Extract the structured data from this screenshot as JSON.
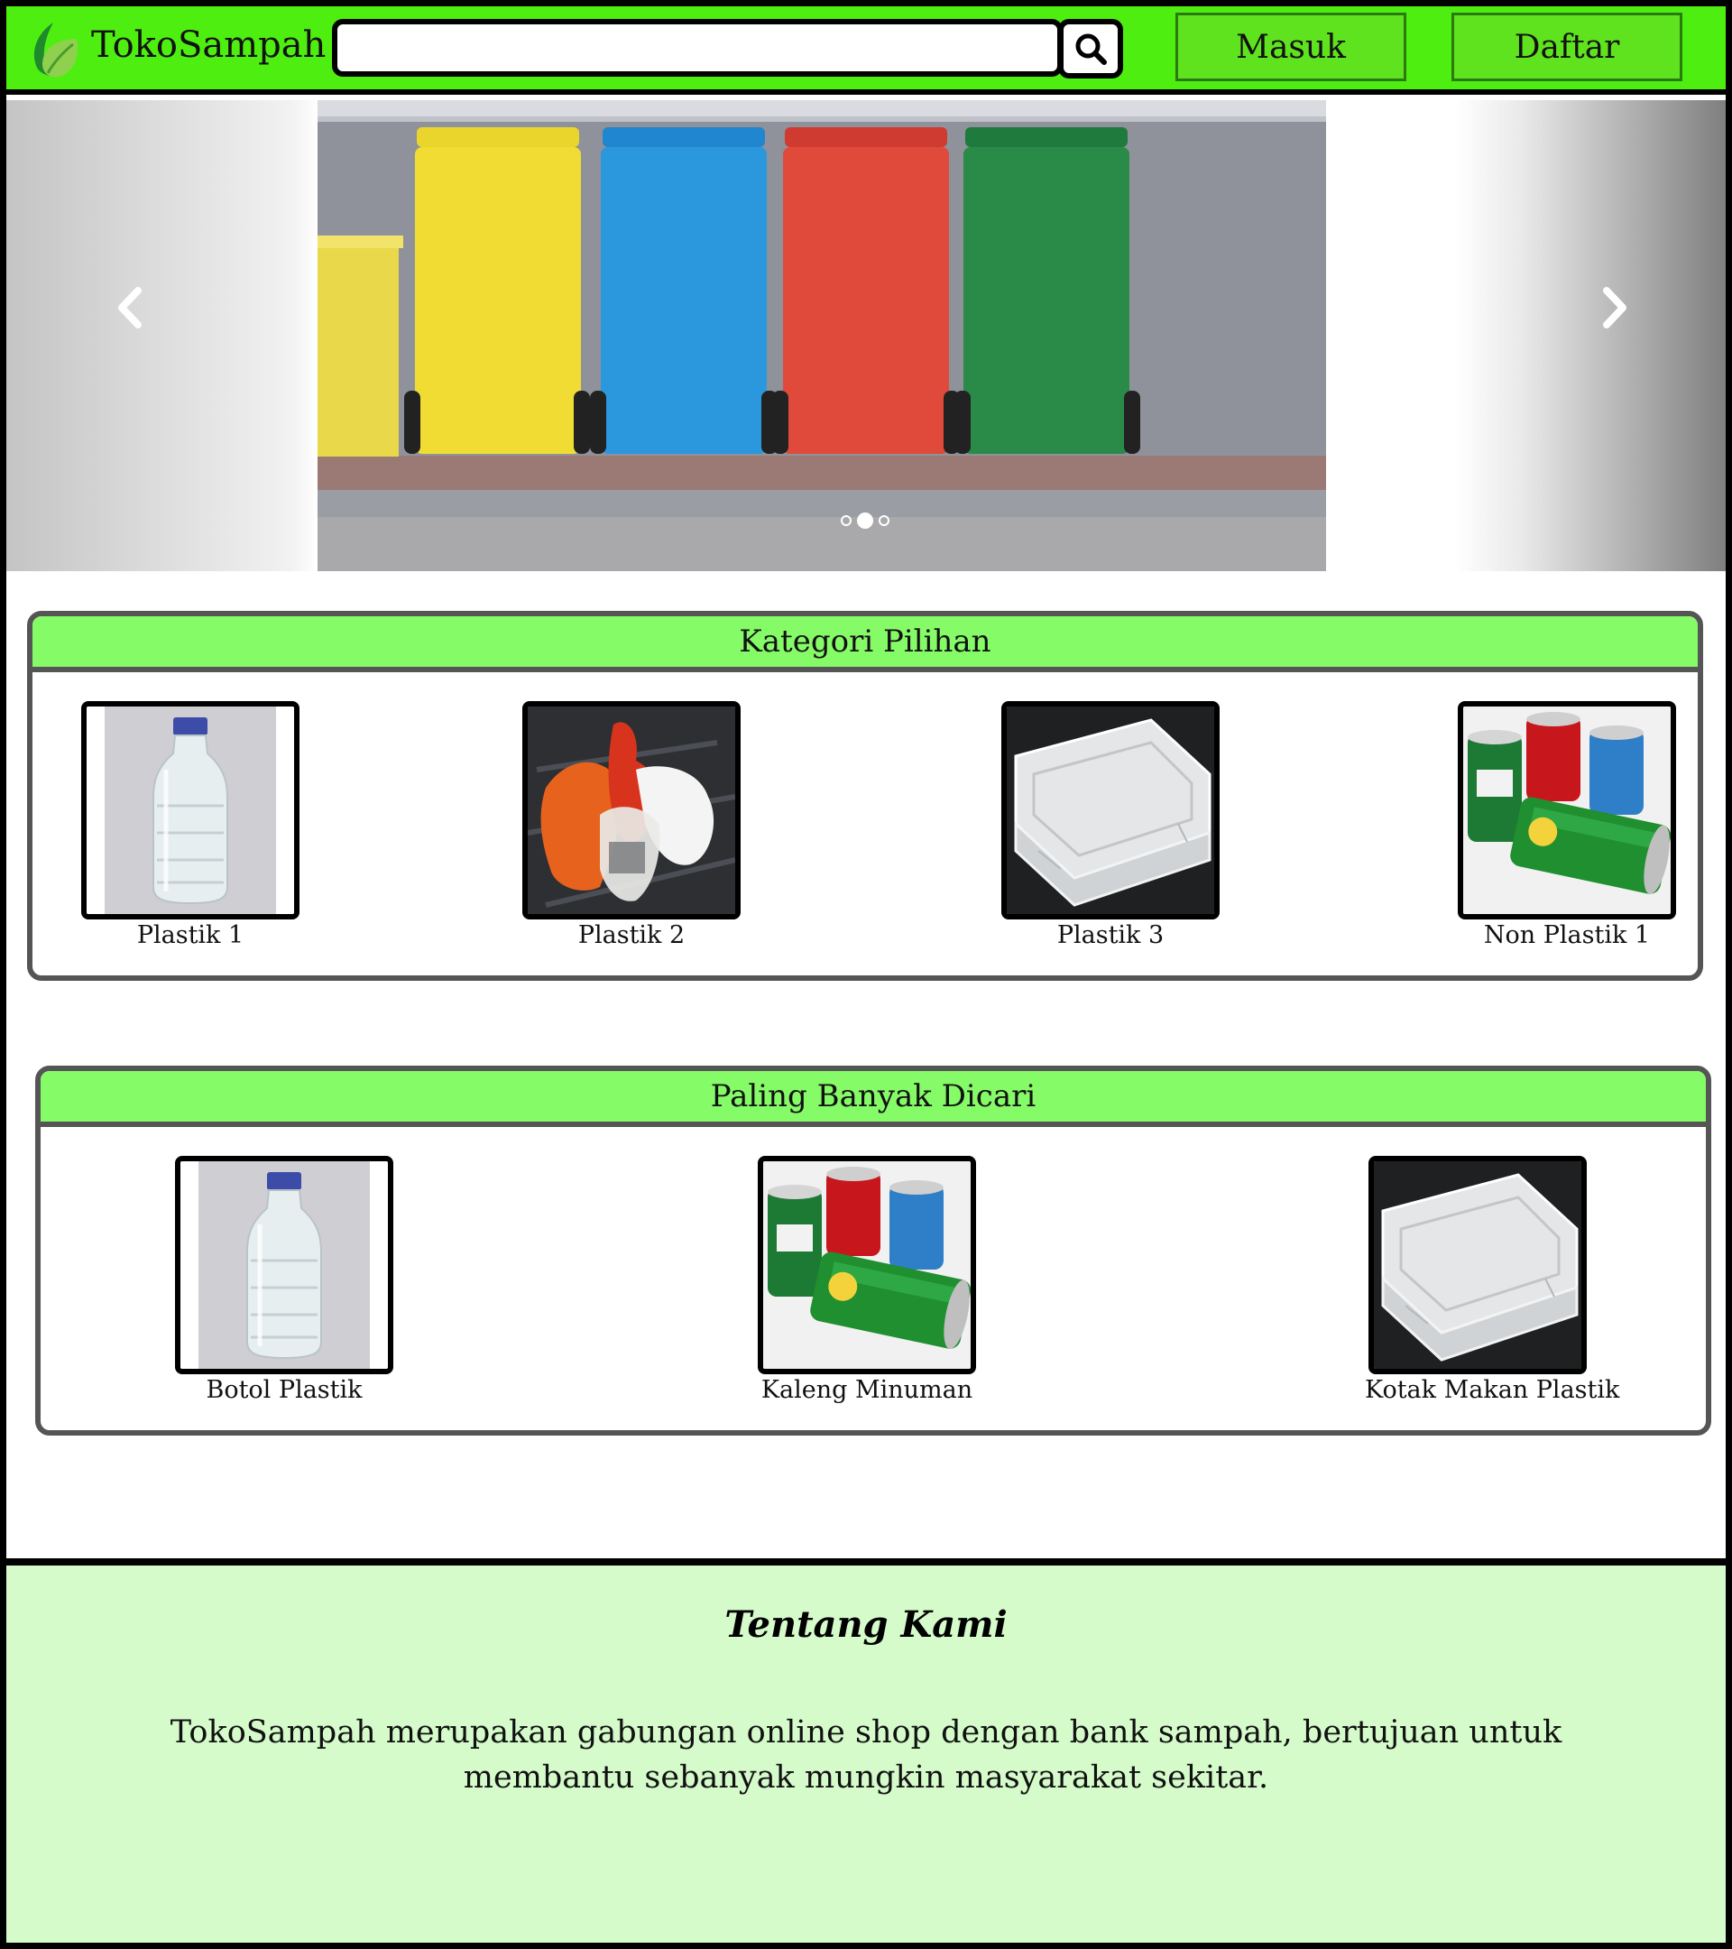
{
  "navbar": {
    "brand": "TokoSampah",
    "search_value": "",
    "login_label": "Masuk",
    "register_label": "Daftar",
    "colors": {
      "bar": "#4eef10",
      "buttons": "#5fe31e"
    },
    "icons": [
      "leaf-logo-icon",
      "search-icon"
    ]
  },
  "carousel": {
    "slide_count": 3,
    "active_slide": 2,
    "image": "colored-waste-bins-photo",
    "icons": [
      "chevron-left-icon",
      "chevron-right-icon"
    ]
  },
  "categories": {
    "title": "Kategori Pilihan",
    "items": [
      {
        "label": "Plastik 1",
        "image": "plastic-bottle"
      },
      {
        "label": "Plastik 2",
        "image": "plastic-bags"
      },
      {
        "label": "Plastik 3",
        "image": "plastic-food-box"
      },
      {
        "label": "Non Plastik 1",
        "image": "drink-cans"
      }
    ]
  },
  "popular": {
    "title": "Paling Banyak Dicari",
    "items": [
      {
        "label": "Botol Plastik",
        "image": "plastic-bottle"
      },
      {
        "label": "Kaleng Minuman",
        "image": "drink-cans"
      },
      {
        "label": "Kotak Makan Plastik",
        "image": "plastic-food-box"
      }
    ]
  },
  "footer": {
    "title": "Tentang Kami",
    "text": "TokoSampah merupakan gabungan online shop dengan bank sampah, bertujuan untuk membantu sebanyak mungkin masyarakat sekitar.",
    "color": "#d5fbcb"
  }
}
